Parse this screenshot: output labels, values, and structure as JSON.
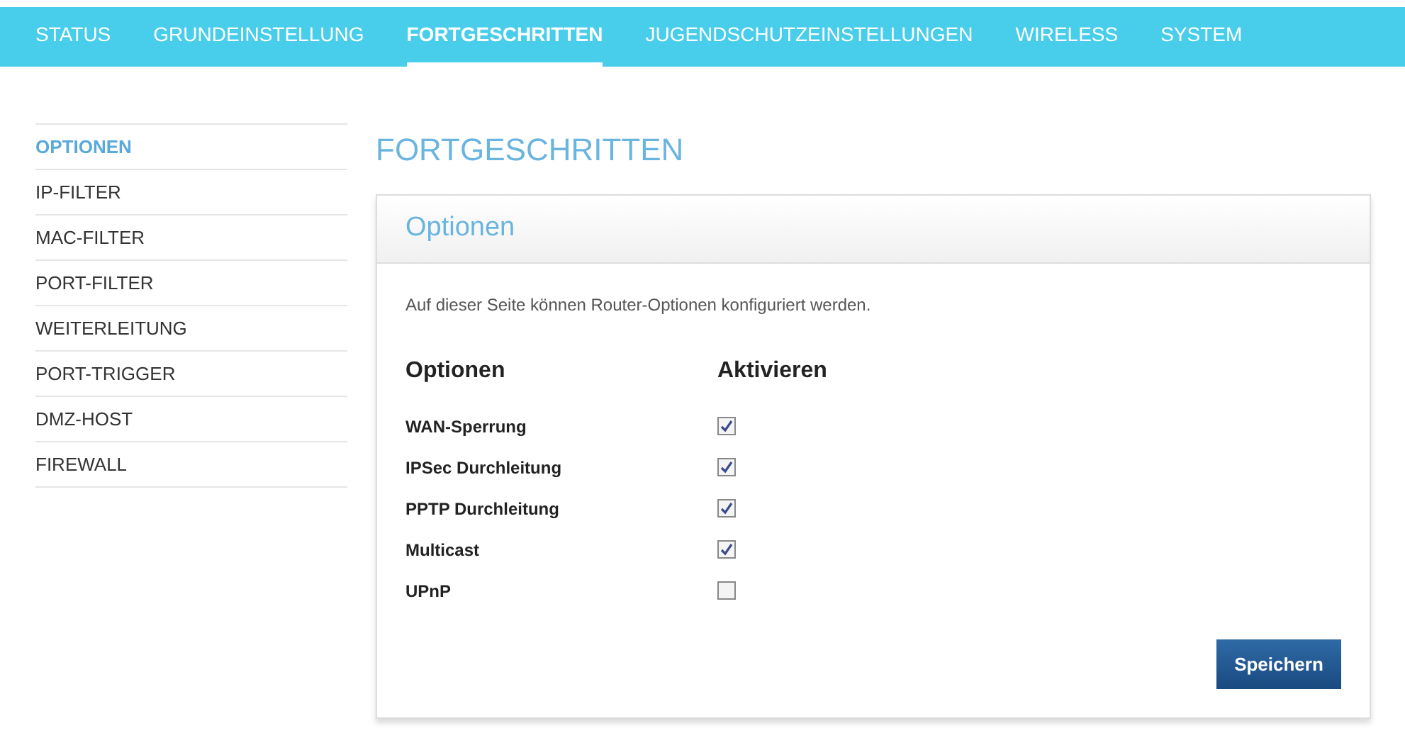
{
  "nav": [
    {
      "label": "STATUS",
      "selected": false
    },
    {
      "label": "GRUNDEINSTELLUNG",
      "selected": false
    },
    {
      "label": "FORTGESCHRITTEN",
      "selected": true
    },
    {
      "label": "JUGENDSCHUTZEINSTELLUNGEN",
      "selected": false
    },
    {
      "label": "WIRELESS",
      "selected": false
    },
    {
      "label": "SYSTEM",
      "selected": false
    }
  ],
  "sidebar": {
    "items": [
      {
        "label": "OPTIONEN",
        "selected": true
      },
      {
        "label": "IP-FILTER",
        "selected": false
      },
      {
        "label": "MAC-FILTER",
        "selected": false
      },
      {
        "label": "PORT-FILTER",
        "selected": false
      },
      {
        "label": "WEITERLEITUNG",
        "selected": false
      },
      {
        "label": "PORT-TRIGGER",
        "selected": false
      },
      {
        "label": "DMZ-HOST",
        "selected": false
      },
      {
        "label": "FIREWALL",
        "selected": false
      }
    ]
  },
  "page_title": "FORTGESCHRITTEN",
  "panel": {
    "title": "Optionen",
    "description": "Auf dieser Seite können Router-Optionen konfiguriert werden.",
    "columns": [
      "Optionen",
      "Aktivieren"
    ],
    "options": [
      {
        "label": "WAN-Sperrung",
        "checked": true
      },
      {
        "label": "IPSec Durchleitung",
        "checked": true
      },
      {
        "label": "PPTP Durchleitung",
        "checked": true
      },
      {
        "label": "Multicast",
        "checked": true
      },
      {
        "label": "UPnP",
        "checked": false
      }
    ],
    "save_button": "Speichern"
  }
}
